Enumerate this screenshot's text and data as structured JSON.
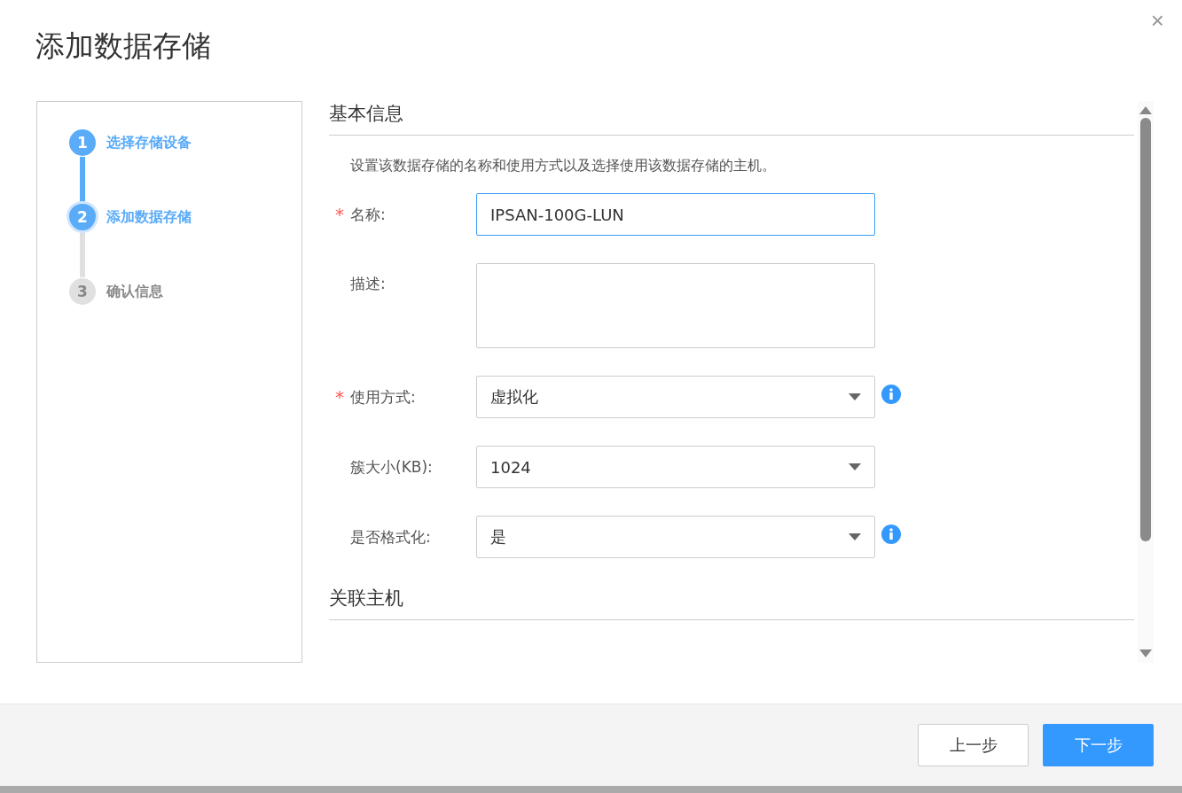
{
  "dialog": {
    "title": "添加数据存储",
    "close": "×"
  },
  "steps": [
    {
      "number": "1",
      "label": "选择存储设备",
      "completed": true,
      "selected": false
    },
    {
      "number": "2",
      "label": "添加数据存储",
      "completed": false,
      "selected": true
    },
    {
      "number": "3",
      "label": "确认信息",
      "completed": false,
      "selected": false
    }
  ],
  "sections": [
    {
      "title": "基本信息",
      "description": "设置该数据存储的名称和使用方式以及选择使用该数据存储的主机。",
      "fields": [
        {
          "kind": "text",
          "required_mark": "*",
          "label": "名称:",
          "value": "IPSAN-100G-LUN",
          "focused": true,
          "info": false
        },
        {
          "kind": "textarea",
          "label": "描述:",
          "focused": false,
          "info": false
        },
        {
          "kind": "select",
          "required_mark": "*",
          "label": "使用方式:",
          "value": "虚拟化",
          "info": true
        },
        {
          "kind": "select",
          "label": "簇大小(KB):",
          "value": "1024",
          "info": false
        },
        {
          "kind": "select",
          "label": "是否格式化:",
          "value": "是",
          "info": true
        }
      ]
    },
    {
      "title": "关联主机"
    }
  ],
  "footer": {
    "buttons": [
      {
        "label": "上一步",
        "kind": "secondary"
      },
      {
        "label": "下一步",
        "kind": "primary"
      }
    ]
  }
}
